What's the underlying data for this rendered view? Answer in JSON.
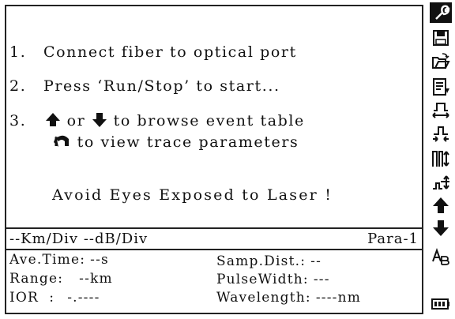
{
  "instructions": {
    "line1": {
      "num": "1.",
      "text": "Connect fiber to optical port"
    },
    "line2": {
      "num": "2.",
      "text": "Press ‘Run/Stop’ to start..."
    },
    "line3": {
      "num": "3.",
      "or_text": "or",
      "after_text": "to browse event table"
    },
    "line4": {
      "text": "to view trace parameters"
    },
    "warning": "Avoid Eyes Exposed to Laser !"
  },
  "scale_bar": {
    "scale": "--Km/Div --dB/Div",
    "page": "Para-1"
  },
  "params": {
    "ave_time": {
      "label": "Ave.Time:",
      "value": "--s"
    },
    "range": {
      "label": "Range:",
      "value": "--km"
    },
    "ior": {
      "label": "IOR  :",
      "value": "-.----"
    },
    "samp_dist": {
      "label": "Samp.Dist.:",
      "value": "--"
    },
    "pulse_width": {
      "label": "PulseWidth:",
      "value": "---"
    },
    "wavelength": {
      "label": "Wavelength:",
      "value": "----nm"
    }
  },
  "toolbar": {
    "icons": [
      "settings-wrench-icon",
      "save-icon",
      "open-folder-icon",
      "event-list-icon",
      "pulse-expand-icon",
      "pulse-compress-icon",
      "vertical-scale-icon",
      "horizontal-scale-icon",
      "arrow-up-icon",
      "arrow-down-icon",
      "font-toggle-icon",
      "battery-icon"
    ]
  }
}
